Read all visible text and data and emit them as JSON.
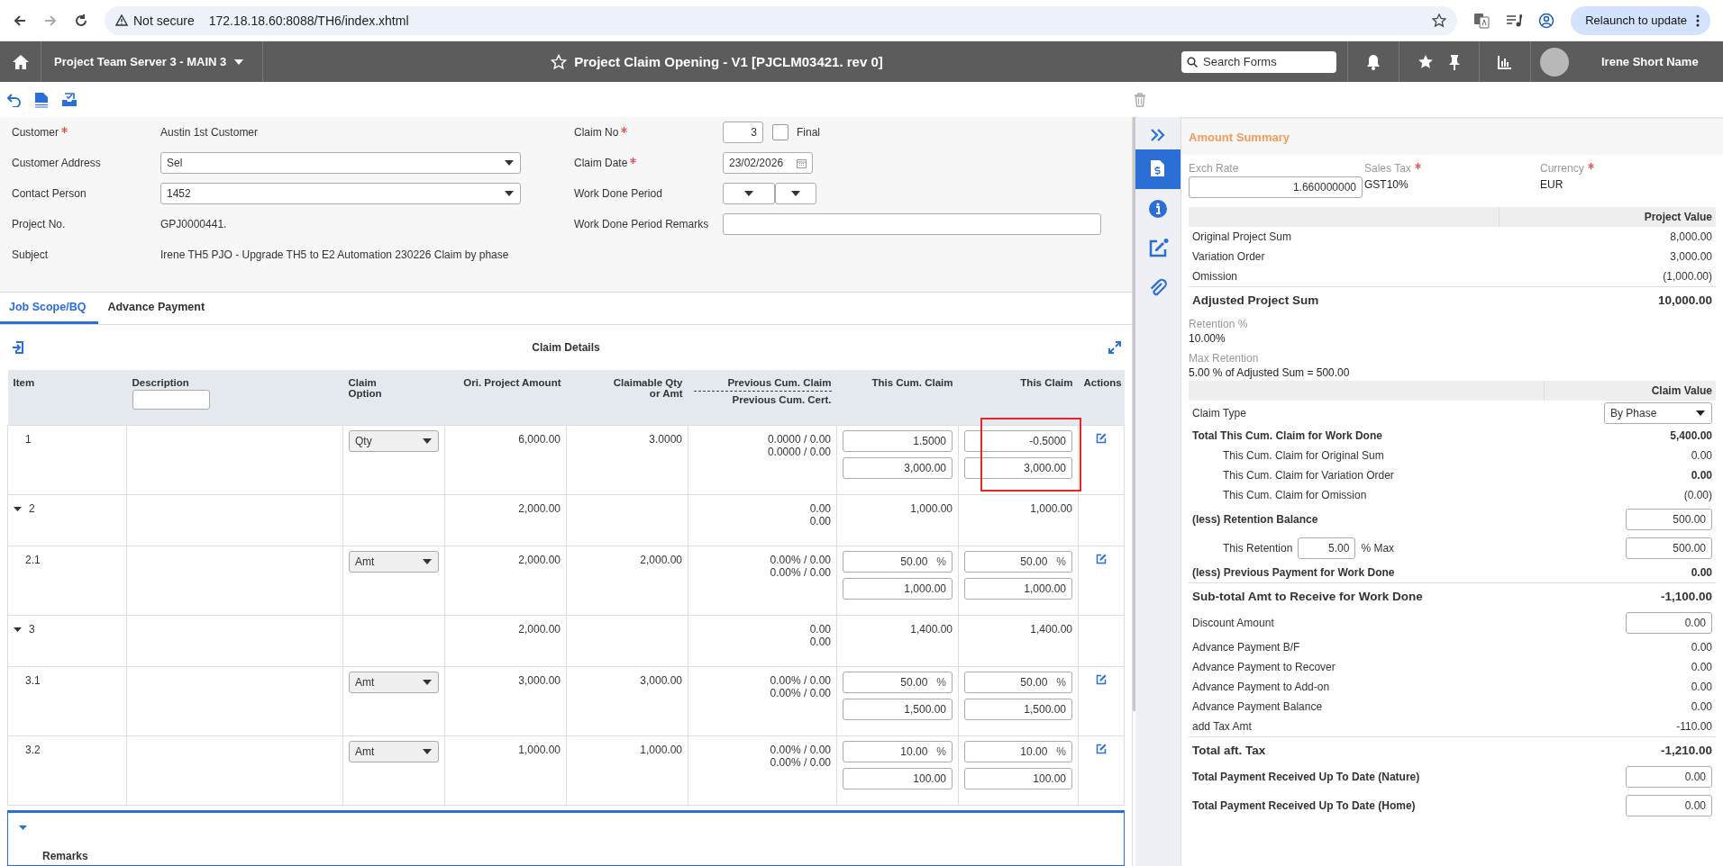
{
  "browser": {
    "security": "Not secure",
    "url": "172.18.18.60:8088/TH6/index.xhtml",
    "relaunch": "Relaunch to update"
  },
  "appbar": {
    "server": "Project Team Server 3 - MAIN 3",
    "title": "Project Claim Opening - V1 [PJCLM03421. rev 0]",
    "search": {
      "placeholder": "Search Forms"
    },
    "user": "Irene Short Name"
  },
  "form": {
    "left": [
      {
        "label": "Customer",
        "required": true,
        "kind": "text",
        "value": "Austin 1st Customer"
      },
      {
        "label": "Customer Address",
        "required": false,
        "kind": "select",
        "value": "Sel"
      },
      {
        "label": "Contact Person",
        "required": false,
        "kind": "select",
        "value": "1452"
      },
      {
        "label": "Project No.",
        "required": false,
        "kind": "text",
        "value": "GPJ0000441."
      },
      {
        "label": "Subject",
        "required": false,
        "kind": "text",
        "value": "Irene TH5 PJO - Upgrade TH5 to E2 Automation 230226 Claim by phase"
      }
    ],
    "right": [
      {
        "label": "Claim No",
        "required": true,
        "kind": "number",
        "value": "3",
        "checkbox": {
          "label": "Final",
          "checked": false
        }
      },
      {
        "label": "Claim Date",
        "required": true,
        "kind": "date",
        "value": "23/02/2026"
      },
      {
        "label": "Work Done Period",
        "required": false,
        "kind": "period"
      },
      {
        "label": "Work Done Period Remarks",
        "required": false,
        "kind": "input"
      }
    ]
  },
  "tabs": [
    {
      "label": "Job Scope/BQ",
      "selected": true
    },
    {
      "label": "Advance Payment",
      "selected": false
    }
  ],
  "claim_details": {
    "title": "Claim Details",
    "columns": [
      {
        "kind": "plain",
        "label": "Item"
      },
      {
        "kind": "filter",
        "label": "Description"
      },
      {
        "kind": "plain",
        "label": "Claim Option"
      },
      {
        "kind": "plain",
        "label": "Ori. Project Amount"
      },
      {
        "kind": "plain",
        "label": "Claimable Qty or Amt"
      },
      {
        "kind": "split",
        "label": "Previous Cum. Claim",
        "label2": "Previous Cum. Cert."
      },
      {
        "kind": "plain",
        "label": "This Cum. Claim"
      },
      {
        "kind": "plain",
        "label": "This Claim"
      },
      {
        "kind": "plain",
        "label": "Actions"
      }
    ],
    "rows": [
      {
        "kind": "item",
        "item": "1",
        "option": "Qty",
        "ori": "6,000.00",
        "claimable": "3.0000",
        "previous": [
          "0.0000 / 0.00",
          "0.0000 / 0.00"
        ],
        "cum": [
          {
            "value": "1.5000"
          },
          {
            "value": "3,000.00"
          }
        ],
        "this": [
          {
            "value": "-0.5000"
          },
          {
            "value": "3,000.00"
          }
        ],
        "highlighted": true
      },
      {
        "kind": "group",
        "item": "2",
        "expanded": true,
        "ori": "2,000.00",
        "previous": [
          "0.00",
          "0.00"
        ],
        "cum": "1,000.00",
        "this": "1,000.00",
        "highlighted": false
      },
      {
        "kind": "item",
        "item": "2.1",
        "option": "Amt",
        "ori": "2,000.00",
        "claimable": "2,000.00",
        "previous": [
          "0.00% / 0.00",
          "0.00% / 0.00"
        ],
        "cum": [
          {
            "value": "50.00",
            "unit": "%"
          },
          {
            "value": "1,000.00"
          }
        ],
        "this": [
          {
            "value": "50.00",
            "unit": "%"
          },
          {
            "value": "1,000.00"
          }
        ],
        "highlighted": false
      },
      {
        "kind": "group",
        "item": "3",
        "expanded": true,
        "ori": "2,000.00",
        "previous": [
          "0.00",
          "0.00"
        ],
        "cum": "1,400.00",
        "this": "1,400.00",
        "highlighted": false
      },
      {
        "kind": "item",
        "item": "3.1",
        "option": "Amt",
        "ori": "3,000.00",
        "claimable": "3,000.00",
        "previous": [
          "0.00% / 0.00",
          "0.00% / 0.00"
        ],
        "cum": [
          {
            "value": "50.00",
            "unit": "%"
          },
          {
            "value": "1,500.00"
          }
        ],
        "this": [
          {
            "value": "50.00",
            "unit": "%"
          },
          {
            "value": "1,500.00"
          }
        ],
        "highlighted": false
      },
      {
        "kind": "item",
        "item": "3.2",
        "option": "Amt",
        "ori": "1,000.00",
        "claimable": "1,000.00",
        "previous": [
          "0.00% / 0.00",
          "0.00% / 0.00"
        ],
        "cum": [
          {
            "value": "10.00",
            "unit": "%"
          },
          {
            "value": "100.00"
          }
        ],
        "this": [
          {
            "value": "10.00",
            "unit": "%"
          },
          {
            "value": "100.00"
          }
        ],
        "highlighted": false
      }
    ]
  },
  "remarks": {
    "label": "Remarks",
    "expanded": true
  },
  "side_icons": [
    {
      "kind": "billing",
      "selected": true,
      "badge": false
    },
    {
      "kind": "info",
      "selected": false,
      "badge": false
    },
    {
      "kind": "edit",
      "selected": false,
      "badge": true
    },
    {
      "kind": "attach",
      "selected": false,
      "badge": false
    }
  ],
  "summary": {
    "title": "Amount Summary",
    "exch_rate": {
      "label": "Exch Rate",
      "value": "1.660000000"
    },
    "sales_tax": {
      "label": "Sales Tax",
      "required": true,
      "value": "GST10%"
    },
    "currency": {
      "label": "Currency",
      "required": true,
      "value": "EUR"
    },
    "project_header": "Project Value",
    "project_rows": [
      {
        "kind": "line",
        "label": "Original Project Sum",
        "value": "8,000.00"
      },
      {
        "kind": "line",
        "label": "Variation Order",
        "value": "3,000.00"
      },
      {
        "kind": "line",
        "label": "Omission",
        "value": "(1,000.00)"
      },
      {
        "kind": "total",
        "label": "Adjusted Project Sum",
        "value": "10,000.00"
      }
    ],
    "retention": {
      "label": "Retention %",
      "value": "10.00%"
    },
    "max_retention": {
      "label": "Max Retention",
      "value": "5.00 % of Adjusted Sum = 500.00"
    },
    "claim_header": "Claim Value",
    "claim_rows": [
      {
        "kind": "select",
        "label": "Claim Type",
        "value": "By Phase"
      },
      {
        "kind": "bold",
        "label": "Total This Cum. Claim for Work Done",
        "value": "5,400.00"
      },
      {
        "kind": "sub",
        "label": "This Cum. Claim for Original Sum",
        "value": "0.00"
      },
      {
        "kind": "substrong",
        "label": "This Cum. Claim for Variation Order",
        "value": "0.00"
      },
      {
        "kind": "sub",
        "label": "This Cum. Claim for Omission",
        "value": "(0.00)"
      },
      {
        "kind": "boldinput",
        "label": "(less) Retention Balance",
        "value": "500.00"
      },
      {
        "kind": "retention",
        "label": "This Retention",
        "input": "5.00",
        "unit": "% Max",
        "value": "500.00"
      },
      {
        "kind": "bold",
        "label": "(less) Previous Payment for Work Done",
        "value": "0.00"
      },
      {
        "kind": "total",
        "label": "Sub-total Amt to Receive for Work Done",
        "value": "-1,100.00"
      },
      {
        "kind": "input",
        "label": "Discount Amount",
        "value": "0.00"
      },
      {
        "kind": "line",
        "label": "Advance Payment B/F",
        "value": "0.00"
      },
      {
        "kind": "line",
        "label": "Advance Payment to Recover",
        "value": "0.00"
      },
      {
        "kind": "line",
        "label": "Advance Payment to Add-on",
        "value": "0.00"
      },
      {
        "kind": "line",
        "label": "Advance Payment Balance",
        "value": "0.00"
      },
      {
        "kind": "line",
        "label": "add Tax Amt",
        "value": "-110.00"
      },
      {
        "kind": "total",
        "label": "Total aft. Tax",
        "value": "-1,210.00"
      },
      {
        "kind": "boldinput",
        "label": "Total Payment Received Up To Date (Nature)",
        "value": "0.00"
      },
      {
        "kind": "boldinput",
        "label": "Total Payment Received Up To Date (Home)",
        "value": "0.00"
      }
    ]
  }
}
